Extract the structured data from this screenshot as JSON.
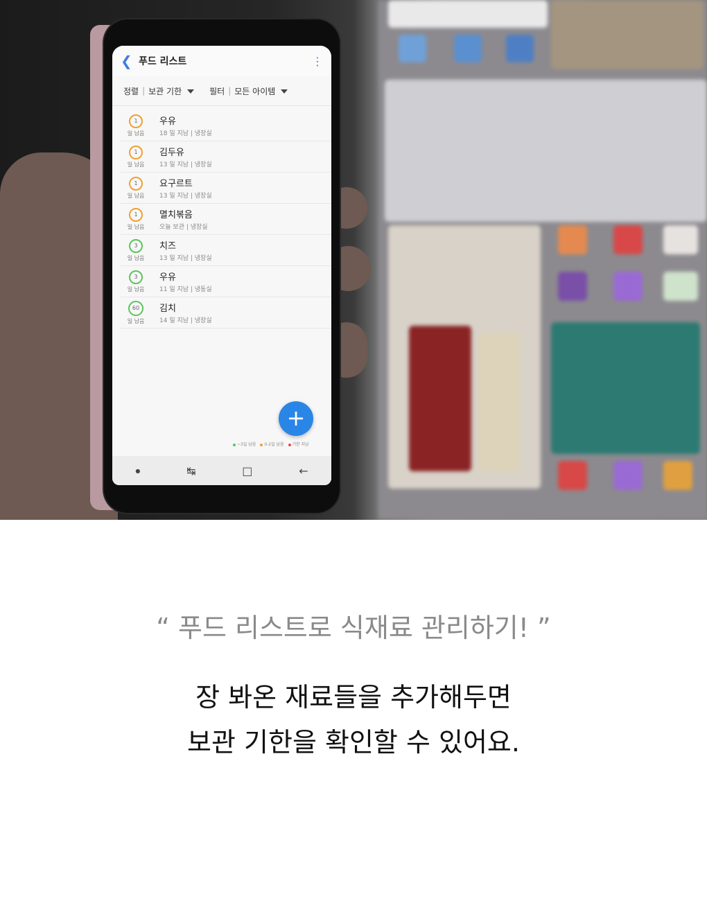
{
  "app": {
    "title": "푸드 리스트",
    "back_icon": "chevron-left-icon",
    "menu_icon": "more-vertical-icon"
  },
  "sort": {
    "label": "정렬",
    "value": "보관 기한",
    "filter_label": "필터",
    "filter_value": "모든 아이템"
  },
  "items": [
    {
      "days": "1",
      "remaining": "일 남음",
      "name": "우유",
      "desc": "18 일 지남 | 냉장실",
      "status_color": "#f0a030"
    },
    {
      "days": "1",
      "remaining": "일 남음",
      "name": "김두유",
      "desc": "13 일 지남 | 냉장실",
      "status_color": "#f0a030"
    },
    {
      "days": "1",
      "remaining": "일 남음",
      "name": "요구르트",
      "desc": "13 일 지남 | 냉장실",
      "status_color": "#f0a030"
    },
    {
      "days": "1",
      "remaining": "일 남음",
      "name": "멸치볶음",
      "desc": "오늘 보관 | 냉장실",
      "status_color": "#f0a030"
    },
    {
      "days": "3",
      "remaining": "일 남음",
      "name": "치즈",
      "desc": "13 일 지남 | 냉장실",
      "status_color": "#5cc45c"
    },
    {
      "days": "3",
      "remaining": "일 남음",
      "name": "우유",
      "desc": "11 일 지남 | 냉동실",
      "status_color": "#5cc45c"
    },
    {
      "days": "60",
      "remaining": "일 남음",
      "name": "김치",
      "desc": "14 일 지남 | 냉장실",
      "status_color": "#5cc45c"
    }
  ],
  "legend": [
    {
      "label": "~3일 남음",
      "color": "#5cc45c"
    },
    {
      "label": "0-2일 남음",
      "color": "#f0a030"
    },
    {
      "label": "기한 지남",
      "color": "#e24b4b"
    }
  ],
  "fab_icon": "plus-icon",
  "caption": {
    "quote": "“ 푸드 리스트로 식재료 관리하기! ”",
    "line1": "장 봐온 재료들을 추가해두면",
    "line2": "보관 기한을 확인할 수 있어요."
  }
}
